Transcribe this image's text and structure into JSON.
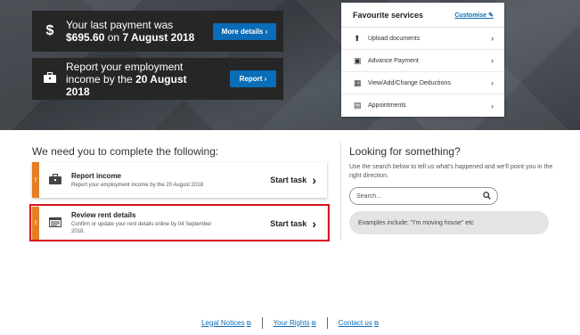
{
  "hero": {
    "payment": {
      "icon": "dollar-icon",
      "line1": "Your last payment was",
      "amount": "$695.60",
      "on": "on",
      "date": "7 August 2018",
      "button": "More details ›"
    },
    "report": {
      "icon": "briefcase-icon",
      "line1": "Report your employment",
      "line2": "income by the",
      "date": "20 August",
      "year": "2018",
      "button": "Report ›"
    }
  },
  "favourites": {
    "title": "Favourite services",
    "customise": "Customise",
    "items": [
      {
        "label": "Upload documents",
        "icon": "upload-icon"
      },
      {
        "label": "Advance Payment",
        "icon": "money-icon"
      },
      {
        "label": "View/Add/Change Deductions",
        "icon": "calendar-icon"
      },
      {
        "label": "Appointments",
        "icon": "appointment-icon"
      }
    ]
  },
  "tasks": {
    "heading": "We need you to complete the following:",
    "items": [
      {
        "title": "Report income",
        "desc": "Report your employment income by the 20 August 2018",
        "action": "Start task",
        "icon": "briefcase-icon"
      },
      {
        "title": "Review rent details",
        "desc": "Confirm or update your rent details online by 04 September 2018.",
        "action": "Start task",
        "icon": "document-icon"
      }
    ]
  },
  "search": {
    "heading": "Looking for something?",
    "help": "Use the search below to tell us what's happened and we'll point you in the right direction.",
    "placeholder": "Search...",
    "examples": "Examples include: \"I'm moving house\" etc"
  },
  "footer": {
    "links": [
      "Legal Notices",
      "Your Rights",
      "Contact us"
    ]
  },
  "colors": {
    "accent": "#0b6cb7",
    "warning": "#e67e22",
    "highlight": "#d9131f",
    "hero_card": "#262626"
  }
}
